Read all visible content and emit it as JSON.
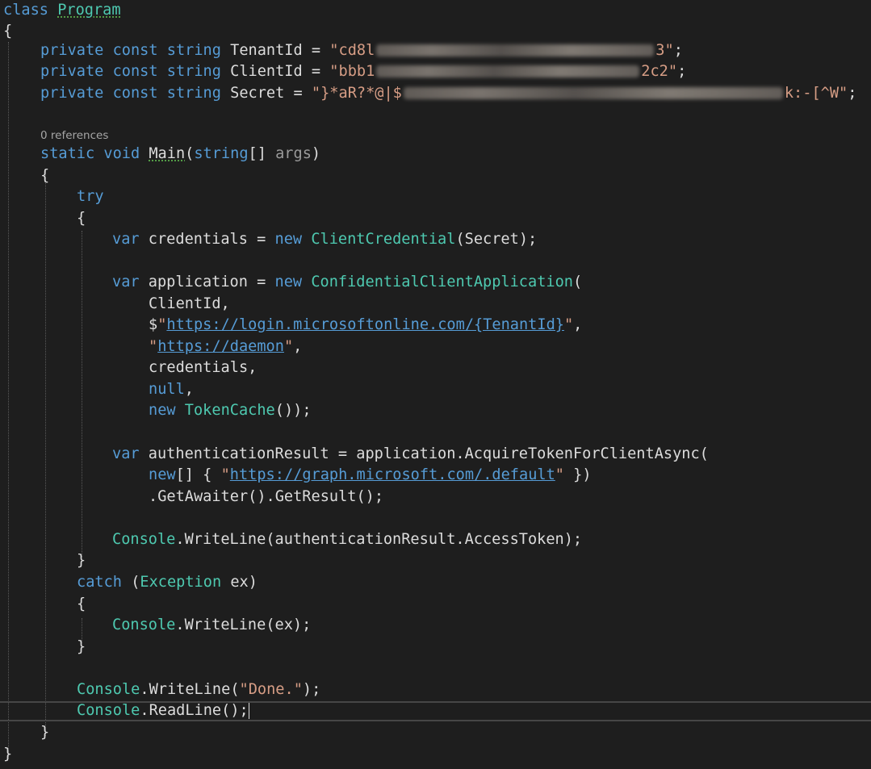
{
  "editor": {
    "codelens": "0 references",
    "t": {
      "class": "class",
      "program": "Program",
      "ob": "{",
      "cb": "}",
      "private": "private",
      "const": "const",
      "string": "string",
      "tenant_id": "TenantId",
      "client_id": "ClientId",
      "secret": "Secret",
      "assign": " = ",
      "q": "\"",
      "semi": ";",
      "tenant_start": "cd8l",
      "tenant_end": "3",
      "client_start": "bbb1",
      "client_end": "2c2",
      "secret_start": "}*aR?*@|$",
      "secret_end": "k:-[^W",
      "static": "static",
      "void": "void",
      "main": "Main",
      "lp": "(",
      "rp": ")",
      "arr": "[]",
      "args": "args",
      "try": "try",
      "var": "var",
      "new": "new",
      "credentials": "credentials",
      "client_credential": "ClientCredential",
      "application": "application",
      "cca": "ConfidentialClientApplication",
      "client_id_arg": "ClientId,",
      "dollar": "$",
      "login_url": "https://login.microsoftonline.com/{TenantId}",
      "daemon_url": "https://daemon",
      "comma": ",",
      "credentials_arg": "credentials,",
      "null": "null",
      "token_cache": "TokenCache",
      "close_new": "());",
      "auth_result": "authenticationResult",
      "acquire": "application.AcquireTokenForClientAsync(",
      "new_arr_open": "[] { ",
      "graph_url": "https://graph.microsoft.com/.default",
      "new_arr_close": " })",
      "get_awaiter": ".GetAwaiter().GetResult();",
      "console": "Console",
      "write_line": ".WriteLine(",
      "access_token": "authenticationResult.AccessToken);",
      "catch": "catch",
      "exception": "Exception",
      "ex_decl": " ex)",
      "ex_arg": "ex);",
      "done": "Done.",
      "close_call": ");",
      "read_line": ".ReadLine();"
    }
  }
}
